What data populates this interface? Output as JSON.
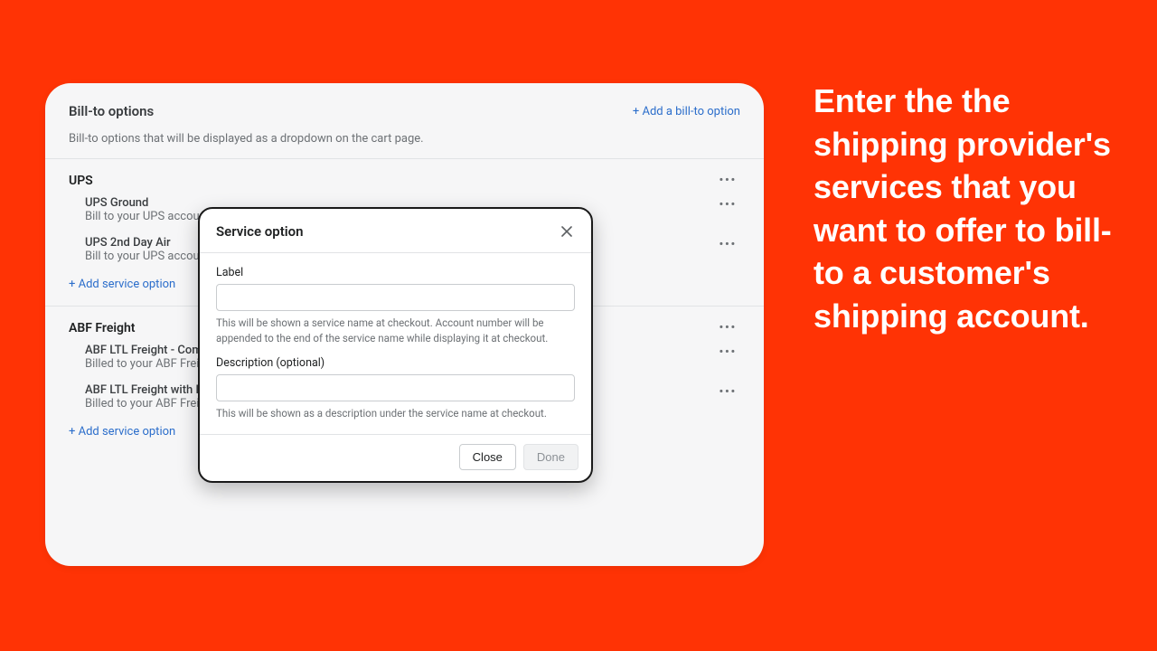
{
  "promo_text": "Enter the the shipping provider's services that you want to offer to bill-to a customer's shipping account.",
  "header": {
    "title": "Bill-to options",
    "subtitle": "Bill-to options that will be displayed as a dropdown on the cart page.",
    "add_link": "+ Add a bill-to option"
  },
  "providers": [
    {
      "name": "UPS",
      "add_service_label": "+ Add service option",
      "services": [
        {
          "name": "UPS Ground",
          "desc": "Bill to your UPS account"
        },
        {
          "name": "UPS 2nd Day Air",
          "desc": "Bill to your UPS account"
        }
      ]
    },
    {
      "name": "ABF Freight",
      "add_service_label": "+ Add service option",
      "services": [
        {
          "name": "ABF LTL Freight - Commerical Address",
          "desc": "Billed to your ABF Freight account."
        },
        {
          "name": "ABF LTL Freight with Lift Gate Delivery - Commercial Address",
          "desc": "Billed to your ABF Freight account."
        }
      ]
    }
  ],
  "modal": {
    "title": "Service option",
    "label_field": {
      "label": "Label",
      "value": "",
      "help": "This will be shown a service name at checkout. Account number will be appended to the end of the service name while displaying it at checkout."
    },
    "desc_field": {
      "label": "Description (optional)",
      "value": "",
      "help": "This will be shown as a description under the service name at checkout."
    },
    "close_btn": "Close",
    "done_btn": "Done"
  },
  "more_glyph": "•••"
}
